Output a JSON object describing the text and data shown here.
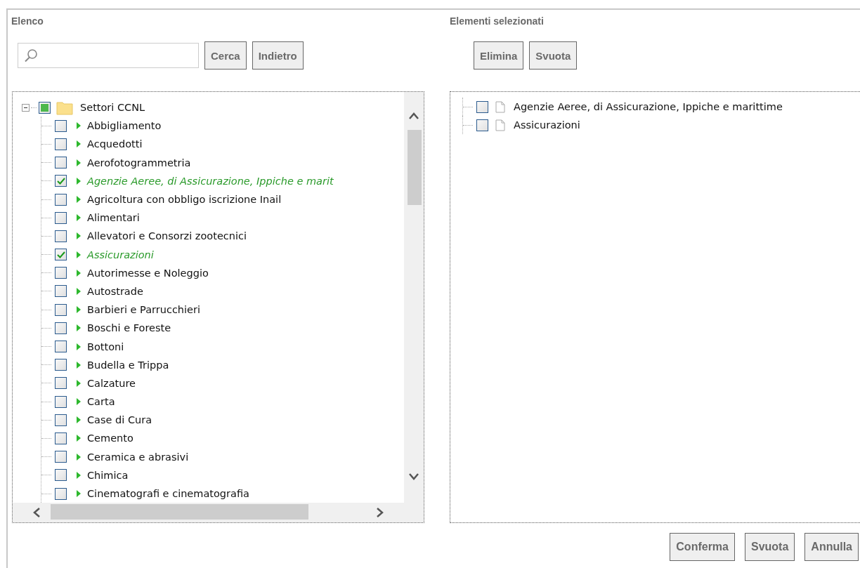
{
  "left_panel": {
    "title": "Elenco",
    "buttons": [
      "Cerca",
      "Indietro"
    ],
    "tree": {
      "label": "Settori CCNL",
      "checked": false,
      "partial": true,
      "expanded": true,
      "children": [
        {
          "label": "Abbigliamento",
          "checked": false
        },
        {
          "label": "Acquedotti",
          "checked": false
        },
        {
          "label": "Aerofotogrammetria",
          "checked": false
        },
        {
          "label": "Agenzie Aeree, di Assicurazione, Ippiche e marit",
          "checked": true
        },
        {
          "label": "Agricoltura con obbligo iscrizione Inail",
          "checked": false
        },
        {
          "label": "Alimentari",
          "checked": false
        },
        {
          "label": "Allevatori e Consorzi zootecnici",
          "checked": false
        },
        {
          "label": "Assicurazioni",
          "checked": true
        },
        {
          "label": "Autorimesse e Noleggio",
          "checked": false
        },
        {
          "label": "Autostrade",
          "checked": false
        },
        {
          "label": "Barbieri e Parrucchieri",
          "checked": false
        },
        {
          "label": "Boschi e Foreste",
          "checked": false
        },
        {
          "label": "Bottoni",
          "checked": false
        },
        {
          "label": "Budella e Trippa",
          "checked": false
        },
        {
          "label": "Calzature",
          "checked": false
        },
        {
          "label": "Carta",
          "checked": false
        },
        {
          "label": "Case di Cura",
          "checked": false
        },
        {
          "label": "Cemento",
          "checked": false
        },
        {
          "label": "Ceramica e abrasivi",
          "checked": false
        },
        {
          "label": "Chimica",
          "checked": false
        },
        {
          "label": "Cinematografi e cinematografia",
          "checked": false
        }
      ]
    }
  },
  "right_panel": {
    "title": "Elementi selezionati",
    "buttons": [
      "Elimina",
      "Svuota"
    ],
    "items": [
      {
        "label": "Agenzie Aeree, di Assicurazione, Ippiche e marittime",
        "checked": false
      },
      {
        "label": "Assicurazioni",
        "checked": false
      }
    ]
  },
  "footer_buttons": [
    "Conferma",
    "Svuota",
    "Annulla"
  ]
}
